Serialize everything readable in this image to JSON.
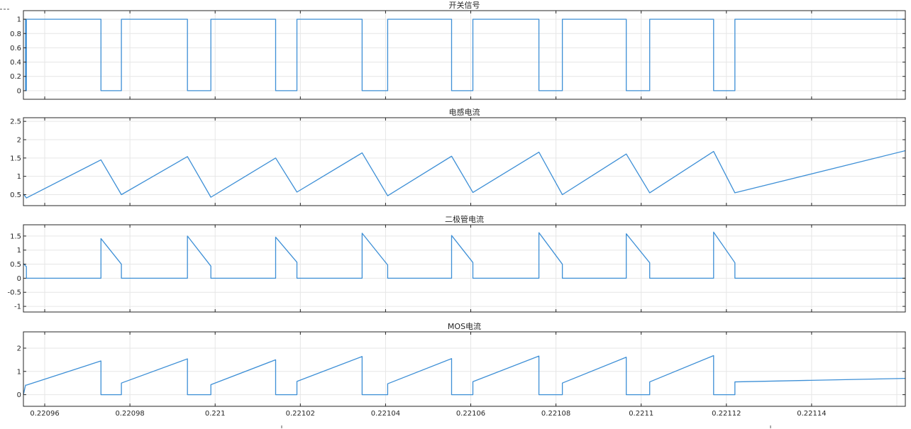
{
  "colors": {
    "series": "#3d8fd6",
    "axis": "#262626",
    "grid": "#e6e6e6"
  },
  "x_tick_labels": [
    "0.22096",
    "0.22098",
    "0.221",
    "0.22102",
    "0.22104",
    "0.22106",
    "0.22108",
    "0.2211",
    "0.22112",
    "0.22114"
  ],
  "chart_data": [
    {
      "type": "line",
      "title": "开关信号",
      "xlim": [
        0.220955,
        0.221162
      ],
      "ylim": [
        -0.12,
        1.12
      ],
      "yticks": [
        0,
        0.2,
        0.4,
        0.6,
        0.8,
        1
      ],
      "ytick_labels": [
        "0",
        "0.2",
        "0.4",
        "0.6",
        "0.8",
        "1"
      ],
      "grid": true,
      "x": [
        0.220955,
        0.2209555,
        0.2209555,
        0.2209557,
        0.2209557,
        0.2209732,
        0.2209732,
        0.220978,
        0.220978,
        0.2209935,
        0.2209935,
        0.220999,
        0.220999,
        0.2210142,
        0.2210142,
        0.2210192,
        0.2210192,
        0.2210345,
        0.2210345,
        0.2210405,
        0.2210405,
        0.2210555,
        0.2210555,
        0.2210605,
        0.2210605,
        0.221076,
        0.221076,
        0.2210815,
        0.2210815,
        0.2210965,
        0.2210965,
        0.221102,
        0.221102,
        0.221117,
        0.221117,
        0.221122,
        0.221122,
        0.221162
      ],
      "y": [
        1,
        1,
        0,
        0,
        1,
        1,
        0,
        0,
        1,
        1,
        0,
        0,
        1,
        1,
        0,
        0,
        1,
        1,
        0,
        0,
        1,
        1,
        0,
        0,
        1,
        1,
        0,
        0,
        1,
        1,
        0,
        0,
        1,
        1,
        0,
        0,
        1,
        1
      ]
    },
    {
      "type": "line",
      "title": "电感电流",
      "xlim": [
        0.220955,
        0.221162
      ],
      "ylim": [
        0.2,
        2.6
      ],
      "yticks": [
        0.5,
        1,
        1.5,
        2,
        2.5
      ],
      "ytick_labels": [
        "0.5",
        "1",
        "1.5",
        "2",
        "2.5"
      ],
      "grid": true,
      "x": [
        0.220955,
        0.2209557,
        0.2209732,
        0.220978,
        0.2209935,
        0.220999,
        0.2210142,
        0.2210192,
        0.2210345,
        0.2210405,
        0.2210555,
        0.2210605,
        0.221076,
        0.2210815,
        0.2210965,
        0.221102,
        0.221117,
        0.221122,
        0.221162
      ],
      "y": [
        0.52,
        0.41,
        1.45,
        0.5,
        1.54,
        0.43,
        1.5,
        0.57,
        1.64,
        0.47,
        1.55,
        0.56,
        1.66,
        0.5,
        1.61,
        0.55,
        1.68,
        0.55,
        1.7
      ]
    },
    {
      "type": "line",
      "title": "二极管电流",
      "xlim": [
        0.220955,
        0.221162
      ],
      "ylim": [
        -1.2,
        1.9
      ],
      "yticks": [
        -1,
        -0.5,
        0,
        0.5,
        1,
        1.5
      ],
      "ytick_labels": [
        "-1",
        "-0.5",
        "0",
        "0.5",
        "1",
        "1.5"
      ],
      "grid": true,
      "x": [
        0.220955,
        0.2209557,
        0.2209557,
        0.2209732,
        0.2209732,
        0.220978,
        0.220978,
        0.2209935,
        0.2209935,
        0.220999,
        0.220999,
        0.2210142,
        0.2210142,
        0.2210192,
        0.2210192,
        0.2210345,
        0.2210345,
        0.2210405,
        0.2210405,
        0.2210555,
        0.2210555,
        0.2210605,
        0.2210605,
        0.221076,
        0.221076,
        0.2210815,
        0.2210815,
        0.2210965,
        0.2210965,
        0.221102,
        0.221102,
        0.221117,
        0.221117,
        0.221122,
        0.221122,
        0.221162
      ],
      "y": [
        0.52,
        0.41,
        0,
        0,
        1.41,
        0.5,
        0,
        0,
        1.5,
        0.43,
        0,
        0,
        1.46,
        0.57,
        0,
        0,
        1.6,
        0.47,
        0,
        0,
        1.52,
        0.56,
        0,
        0,
        1.62,
        0.5,
        0,
        0,
        1.58,
        0.55,
        0,
        0,
        1.64,
        0.55,
        0,
        0
      ]
    },
    {
      "type": "line",
      "title": "MOS电流",
      "xlim": [
        0.220955,
        0.221162
      ],
      "ylim": [
        -0.5,
        2.7
      ],
      "yticks": [
        0,
        1,
        2
      ],
      "ytick_labels": [
        "0",
        "1",
        "2"
      ],
      "grid": true,
      "x": [
        0.220955,
        0.2209555,
        0.2209557,
        0.2209732,
        0.2209732,
        0.220978,
        0.220978,
        0.2209935,
        0.2209935,
        0.220999,
        0.220999,
        0.2210142,
        0.2210142,
        0.2210192,
        0.2210192,
        0.2210345,
        0.2210345,
        0.2210405,
        0.2210405,
        0.2210555,
        0.2210555,
        0.2210605,
        0.2210605,
        0.221076,
        0.221076,
        0.2210815,
        0.2210815,
        0.2210965,
        0.2210965,
        0.221102,
        0.221102,
        0.221117,
        0.221117,
        0.221122,
        0.221122,
        0.221162
      ],
      "y": [
        0,
        0.41,
        0.41,
        1.45,
        0,
        0,
        0.5,
        1.54,
        0,
        0,
        0.43,
        1.5,
        0,
        0,
        0.57,
        1.64,
        0,
        0,
        0.47,
        1.55,
        0,
        0,
        0.56,
        1.66,
        0,
        0,
        0.5,
        1.61,
        0,
        0,
        0.55,
        1.68,
        0,
        0,
        0.55,
        0.7
      ]
    }
  ]
}
